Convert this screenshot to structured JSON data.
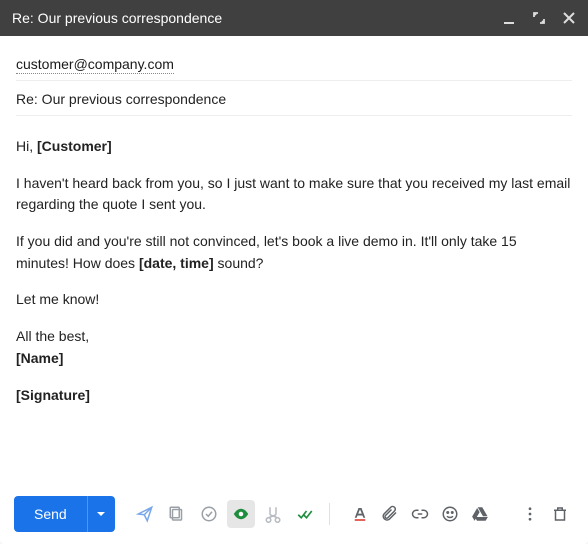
{
  "header": {
    "title": "Re: Our previous correspondence"
  },
  "recipient": "customer@company.com",
  "subject": "Re: Our previous correspondence",
  "body": {
    "greeting_pre": "Hi, ",
    "greeting_ph": "[Customer]",
    "para1": "I haven't heard back from you, so I just want to make sure that you received my last email regarding the quote I sent you.",
    "para2_pre": "If you did and you're still not convinced, let's book a live demo in. It'll only take 15 minutes! How does ",
    "para2_ph": "[date, time]",
    "para2_post": " sound?",
    "para3": "Let me know!",
    "signoff": "All the best,",
    "name_ph": "[Name]",
    "signature_ph": "[Signature]"
  },
  "footer": {
    "send_label": "Send"
  }
}
